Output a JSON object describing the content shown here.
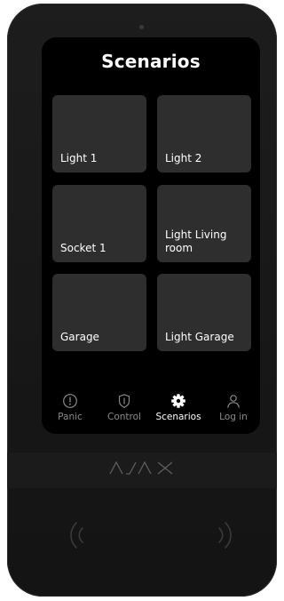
{
  "screen": {
    "title": "Scenarios"
  },
  "tiles": [
    {
      "label": "Light 1"
    },
    {
      "label": "Light 2"
    },
    {
      "label": "Socket 1"
    },
    {
      "label": "Light Living room"
    },
    {
      "label": "Garage"
    },
    {
      "label": "Light Garage"
    }
  ],
  "nav": [
    {
      "label": "Panic",
      "icon": "exclamation-circle-icon"
    },
    {
      "label": "Control",
      "icon": "shield-icon"
    },
    {
      "label": "Scenarios",
      "icon": "gear-icon",
      "active": true
    },
    {
      "label": "Log in",
      "icon": "user-icon"
    }
  ],
  "device": {
    "brand": "AJAX"
  },
  "colors": {
    "active": "#ffffff",
    "inactive": "#8a8a8a",
    "tile": "#2e2e2e"
  }
}
